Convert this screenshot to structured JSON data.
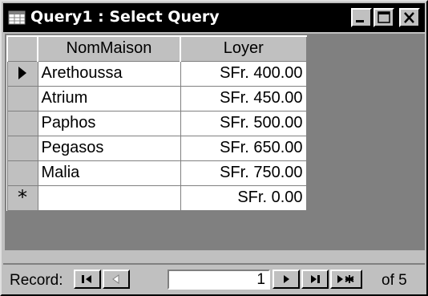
{
  "window": {
    "title": "Query1 : Select Query"
  },
  "grid": {
    "columns": [
      "NomMaison",
      "Loyer"
    ],
    "rows": [
      {
        "NomMaison": "Arethoussa",
        "Loyer": "SFr. 400.00",
        "current": true
      },
      {
        "NomMaison": "Atrium",
        "Loyer": "SFr. 450.00"
      },
      {
        "NomMaison": "Paphos",
        "Loyer": "SFr. 500.00"
      },
      {
        "NomMaison": "Pegasos",
        "Loyer": "SFr. 650.00"
      },
      {
        "NomMaison": "Malia",
        "Loyer": "SFr. 750.00"
      }
    ],
    "new_row": {
      "marker": "*",
      "NomMaison": "",
      "Loyer": "SFr. 0.00"
    }
  },
  "navigator": {
    "label": "Record:",
    "current_record": "1",
    "total_label": "of 5"
  }
}
